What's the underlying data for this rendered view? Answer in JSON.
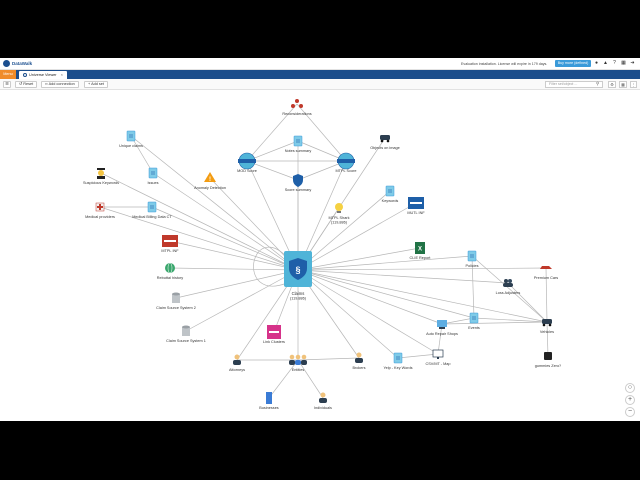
{
  "app": {
    "brand": "DataWalk",
    "eval_notice": "Evaluation installation. License will expire in 179 days.",
    "buy_label": "Buy more (defined)",
    "menu_label": "Menu",
    "tab_label": "Universe Viewer",
    "icons": [
      "user-icon",
      "bell-icon",
      "help-icon",
      "grid-icon",
      "logout-icon"
    ]
  },
  "toolbar": {
    "reset_label": "Reset",
    "add_connection_label": "Add connection",
    "add_set_label": "Add set",
    "search_placeholder": "Filter set/object ..."
  },
  "colors": {
    "edge": "#b7b7b7",
    "claims": "#4fb4d8",
    "brand": "#1c4e8c",
    "menu": "#f08c2a"
  },
  "nodes": [
    {
      "id": "claims",
      "label": "Claims",
      "sub": "(119,886)",
      "icon": "shield-document-icon"
    },
    {
      "id": "reconsiderations",
      "label": "Reconsiderations",
      "icon": "network-icon"
    },
    {
      "id": "notes_summary",
      "label": "Notes summary",
      "icon": "document-icon"
    },
    {
      "id": "mod_score",
      "label": "MOD Score",
      "icon": "scoring-icon"
    },
    {
      "id": "mtpl_score",
      "label": "MTPL Score",
      "icon": "scoring-icon"
    },
    {
      "id": "score_summary",
      "label": "Score summary",
      "icon": "shield-icon"
    },
    {
      "id": "objects_on_image",
      "label": "Objects on image",
      "icon": "car-icon"
    },
    {
      "id": "unique_claims",
      "label": "Unique claims",
      "icon": "document-icon"
    },
    {
      "id": "suspicious_keywords",
      "label": "Suspicious Keywords",
      "icon": "detective-icon"
    },
    {
      "id": "issues",
      "label": "Issues",
      "icon": "document-icon"
    },
    {
      "id": "anomaly_detection",
      "label": "Anomaly Detection",
      "icon": "warning-icon"
    },
    {
      "id": "keywords",
      "label": "Keywords",
      "icon": "document-icon"
    },
    {
      "id": "mtpl_shark",
      "label": "MTPL Shark",
      "sub": "(119,886)",
      "icon": "lightbulb-icon"
    },
    {
      "id": "mutual_info",
      "label": "MUTL INF",
      "icon": "workflow-icon"
    },
    {
      "id": "medical_providers",
      "label": "Medical providers",
      "icon": "hospital-icon"
    },
    {
      "id": "medical_billing",
      "label": "Medical Billing Data CT",
      "icon": "document-icon"
    },
    {
      "id": "medical_info",
      "label": "MTPL INF",
      "icon": "workflow-icon"
    },
    {
      "id": "csv_report",
      "label": "CLIE Report",
      "icon": "excel-icon"
    },
    {
      "id": "policies",
      "label": "Policies",
      "icon": "document-icon"
    },
    {
      "id": "rebuttal_history",
      "label": "Rebuttal history",
      "icon": "globe-icon"
    },
    {
      "id": "premium_cars",
      "label": "Premium Cars",
      "icon": "sports-car-icon"
    },
    {
      "id": "loss_adjusters",
      "label": "Loss Adjusters",
      "icon": "people-icon"
    },
    {
      "id": "claim_src2",
      "label": "Claim Source System 2",
      "icon": "database-icon"
    },
    {
      "id": "claim_src1",
      "label": "Claim Source System 1",
      "icon": "database-icon"
    },
    {
      "id": "link_clusters",
      "label": "Link Clusters",
      "icon": "cluster-icon"
    },
    {
      "id": "vehicles",
      "label": "Vehicles",
      "icon": "car-icon"
    },
    {
      "id": "events",
      "label": "Events",
      "icon": "document-icon"
    },
    {
      "id": "auto_repair",
      "label": "Auto Repair Shops",
      "icon": "wrench-icon"
    },
    {
      "id": "csv_map",
      "label": "CSV/MT - Map",
      "icon": "monitor-icon"
    },
    {
      "id": "gummies",
      "label": "gummies Zero?",
      "icon": "chip-icon"
    },
    {
      "id": "attorneys",
      "label": "Attorneys",
      "icon": "person-icon"
    },
    {
      "id": "entities",
      "label": "Entities",
      "icon": "group-icon"
    },
    {
      "id": "brokers",
      "label": "Brokers",
      "icon": "person-icon"
    },
    {
      "id": "yelp",
      "label": "Yelp - Key Words",
      "icon": "document-icon"
    },
    {
      "id": "businesses",
      "label": "Businesses",
      "icon": "building-icon"
    },
    {
      "id": "individuals",
      "label": "Individuals",
      "icon": "person-icon"
    }
  ],
  "zoom": {
    "fit_icon": "fit-icon",
    "zoom_in": "+",
    "zoom_out": "−"
  }
}
